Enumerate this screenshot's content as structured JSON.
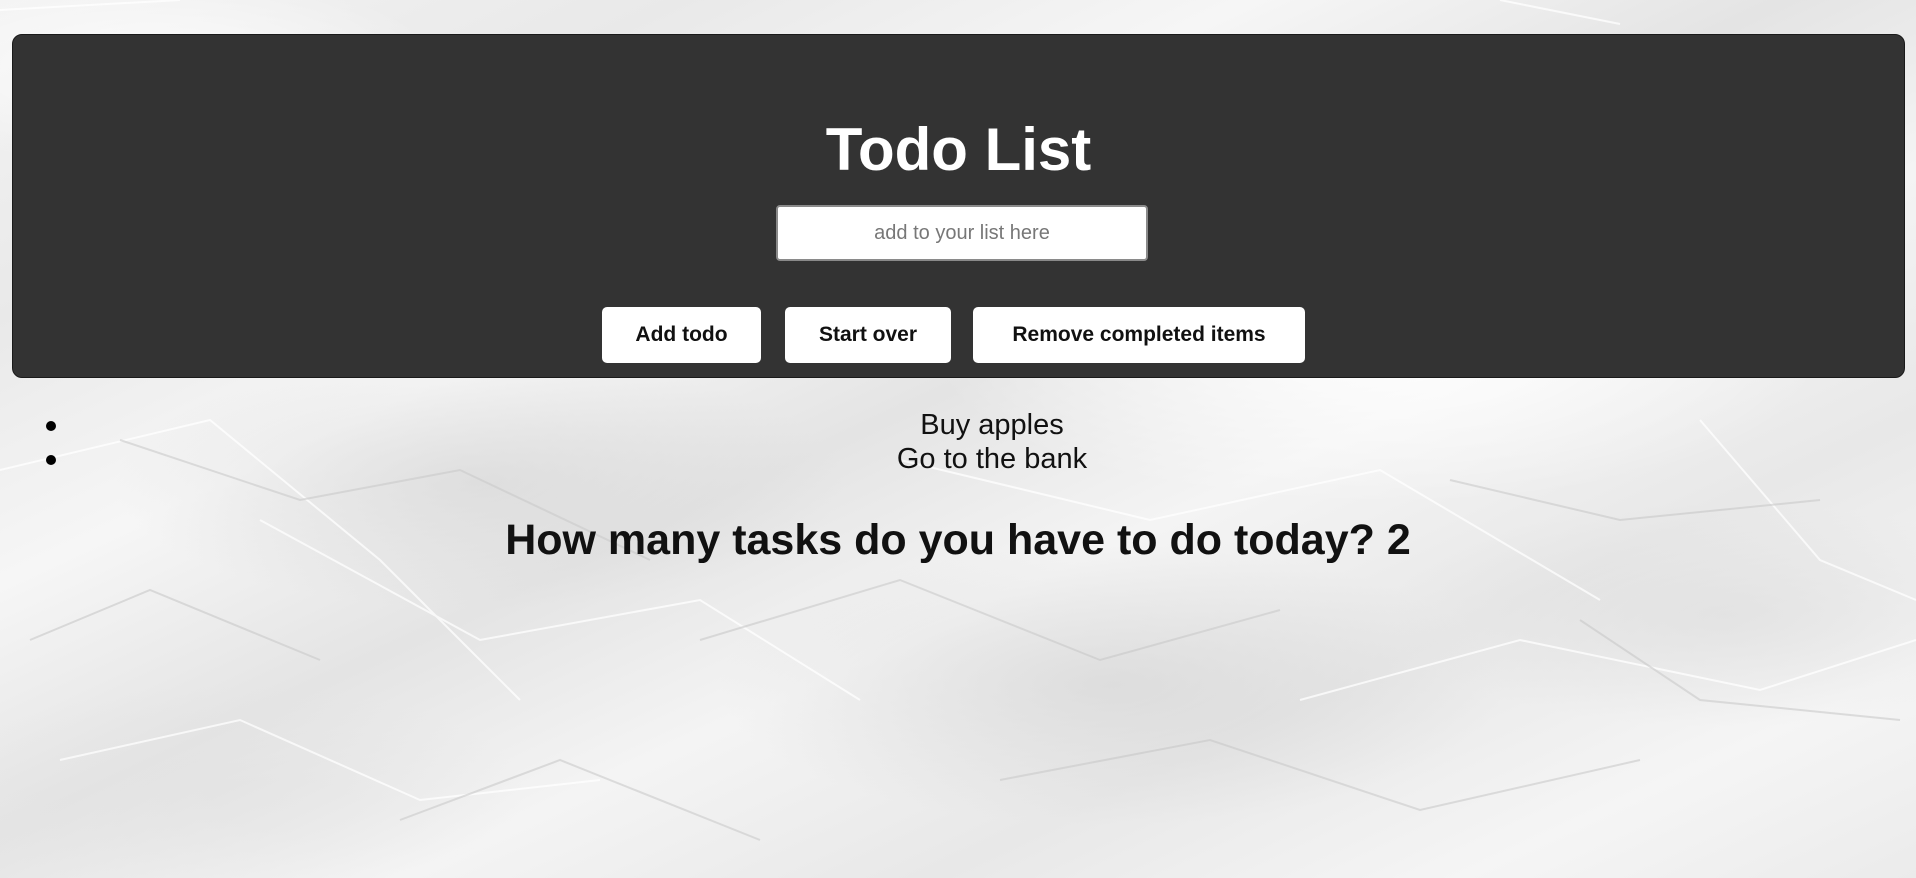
{
  "header": {
    "title": "Todo List"
  },
  "input": {
    "placeholder": "add to your list here",
    "value": ""
  },
  "buttons": {
    "add_label": "Add todo",
    "start_over_label": "Start over",
    "remove_completed_label": "Remove completed items"
  },
  "todos": [
    {
      "text": "Buy apples"
    },
    {
      "text": "Go to the bank"
    }
  ],
  "summary": {
    "question": "How many tasks do you have to do today?",
    "count": "2"
  },
  "colors": {
    "header_background": "#333333",
    "header_text": "#ffffff",
    "button_background": "#ffffff",
    "page_text": "#111111"
  }
}
